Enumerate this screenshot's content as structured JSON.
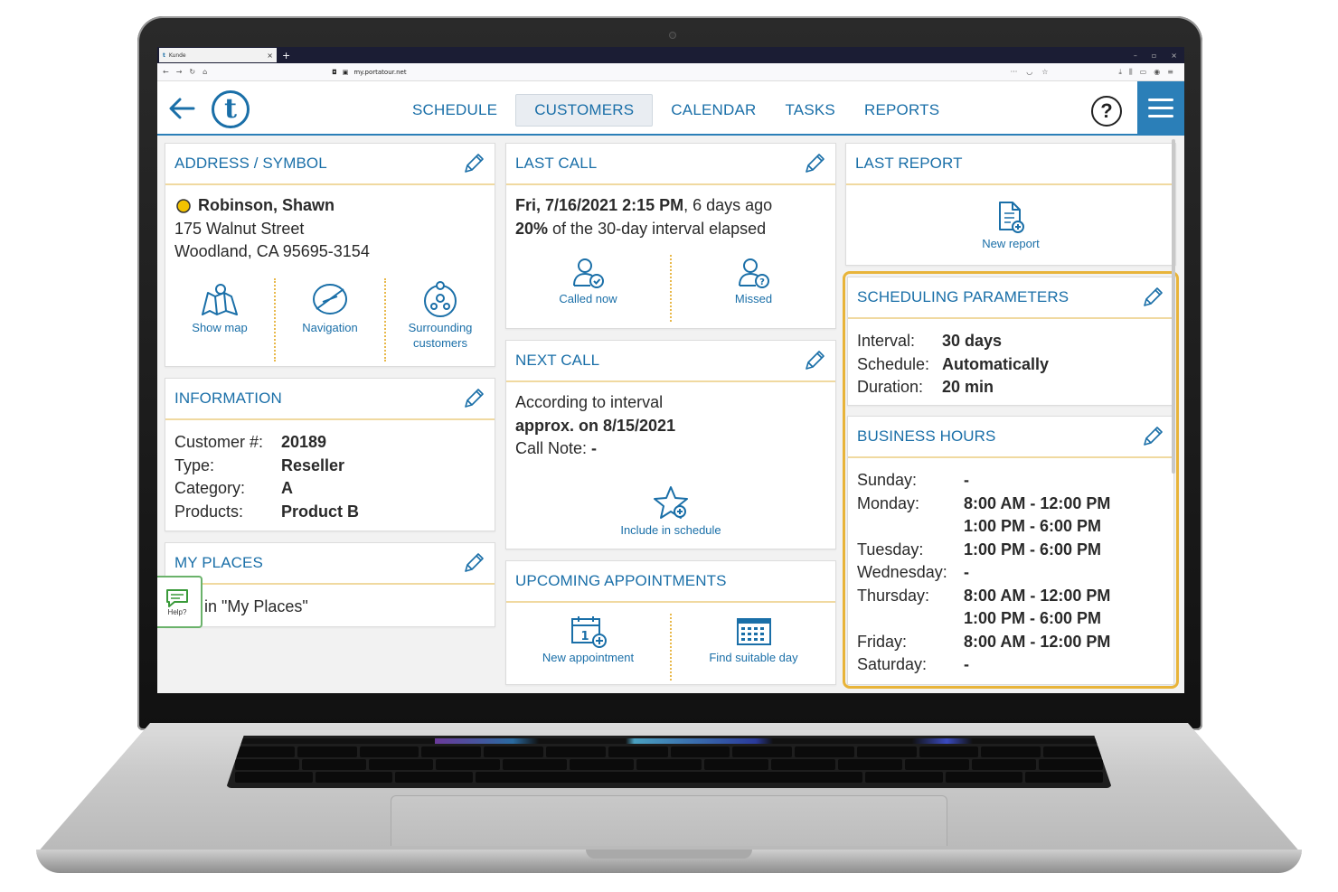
{
  "browser": {
    "tab_title": "Kunde",
    "url": "my.portatour.net"
  },
  "nav": {
    "items": [
      "SCHEDULE",
      "CUSTOMERS",
      "CALENDAR",
      "TASKS",
      "REPORTS"
    ],
    "active": "CUSTOMERS",
    "help_label": "?",
    "logo_letter": "t"
  },
  "address": {
    "title": "ADDRESS / SYMBOL",
    "name": "Robinson, Shawn",
    "street": "175 Walnut Street",
    "city": "Woodland, CA 95695-3154",
    "actions": [
      "Show map",
      "Navigation",
      "Surrounding customers"
    ]
  },
  "information": {
    "title": "INFORMATION",
    "rows": [
      {
        "label": "Customer #:",
        "value": "20189"
      },
      {
        "label": "Type:",
        "value": "Reseller"
      },
      {
        "label": "Category:",
        "value": "A"
      },
      {
        "label": "Products:",
        "value": "Product B"
      }
    ]
  },
  "my_places": {
    "title": "MY PLACES",
    "text": "Not in \"My Places\""
  },
  "help_fab": {
    "label": "Help?"
  },
  "last_call": {
    "title": "LAST CALL",
    "date_bold": "Fri, 7/16/2021 2:15 PM",
    "date_rest": ", 6 days ago",
    "pct_bold": "20%",
    "pct_rest": " of the 30-day interval elapsed",
    "actions": [
      "Called now",
      "Missed"
    ]
  },
  "next_call": {
    "title": "NEXT CALL",
    "line1": "According to interval",
    "line2": "approx. on 8/15/2021",
    "note_label": "Call Note: ",
    "note_value": "-",
    "action": "Include in schedule"
  },
  "upcoming": {
    "title": "UPCOMING APPOINTMENTS",
    "actions": [
      "New appointment",
      "Find suitable day"
    ]
  },
  "last_report": {
    "title": "LAST REPORT",
    "action": "New report"
  },
  "scheduling": {
    "title": "SCHEDULING PARAMETERS",
    "rows": [
      {
        "label": "Interval:",
        "value": "30 days"
      },
      {
        "label": "Schedule:",
        "value": "Automatically"
      },
      {
        "label": "Duration:",
        "value": "20 min"
      }
    ]
  },
  "business_hours": {
    "title": "BUSINESS HOURS",
    "rows": [
      {
        "day": "Sunday:",
        "hours": "-"
      },
      {
        "day": "Monday:",
        "hours": "8:00 AM - 12:00 PM"
      },
      {
        "day": "",
        "hours": "1:00 PM - 6:00 PM"
      },
      {
        "day": "Tuesday:",
        "hours": "1:00 PM - 6:00 PM"
      },
      {
        "day": "Wednesday:",
        "hours": "-"
      },
      {
        "day": "Thursday:",
        "hours": "8:00 AM - 12:00 PM"
      },
      {
        "day": "",
        "hours": "1:00 PM - 6:00 PM"
      },
      {
        "day": "Friday:",
        "hours": "8:00 AM - 12:00 PM"
      },
      {
        "day": "Saturday:",
        "hours": "-"
      }
    ]
  },
  "colors": {
    "brand_blue": "#1a6fa8",
    "accent_gold": "#e8b43a",
    "symbol_yellow": "#f2c200"
  }
}
